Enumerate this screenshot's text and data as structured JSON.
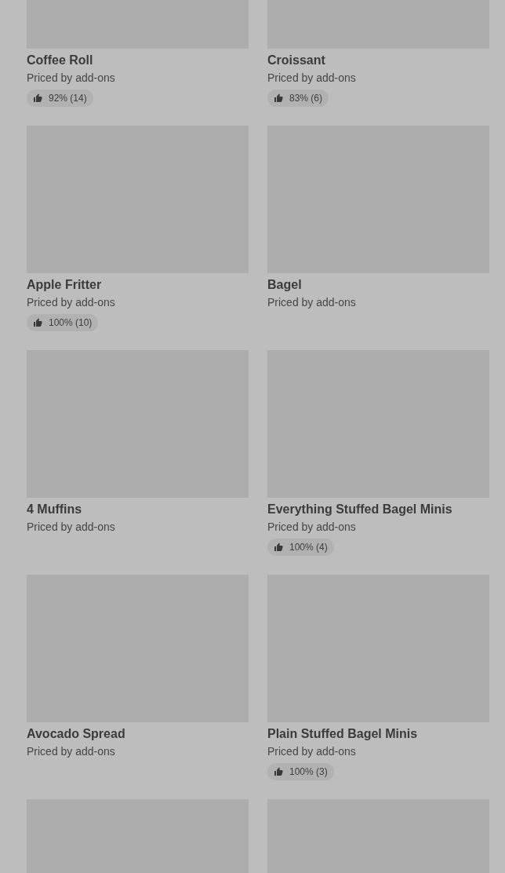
{
  "items": [
    {
      "kind": "product",
      "name": "Coffee Roll",
      "price": "Priced by add-ons",
      "rating": "92% (14)"
    },
    {
      "kind": "product",
      "name": "Croissant",
      "price": "Priced by add-ons",
      "rating": "83% (6)"
    },
    {
      "kind": "product",
      "name": "Apple Fritter",
      "price": "Priced by add-ons",
      "rating": "100% (10)"
    },
    {
      "kind": "product",
      "name": "Bagel",
      "price": "Priced by add-ons"
    },
    {
      "kind": "product",
      "name": "4 Muffins",
      "price": "Priced by add-ons"
    },
    {
      "kind": "product",
      "name": "Everything Stuffed Bagel Minis",
      "price": "Priced by add-ons",
      "rating": "100% (4)"
    },
    {
      "kind": "product",
      "name": "Avocado Spread",
      "price": "Priced by add-ons"
    },
    {
      "kind": "product",
      "name": "Plain Stuffed Bagel Minis",
      "price": "Priced by add-ons",
      "rating": "100% (3)"
    },
    {
      "kind": "image_only"
    },
    {
      "kind": "image_only"
    }
  ]
}
